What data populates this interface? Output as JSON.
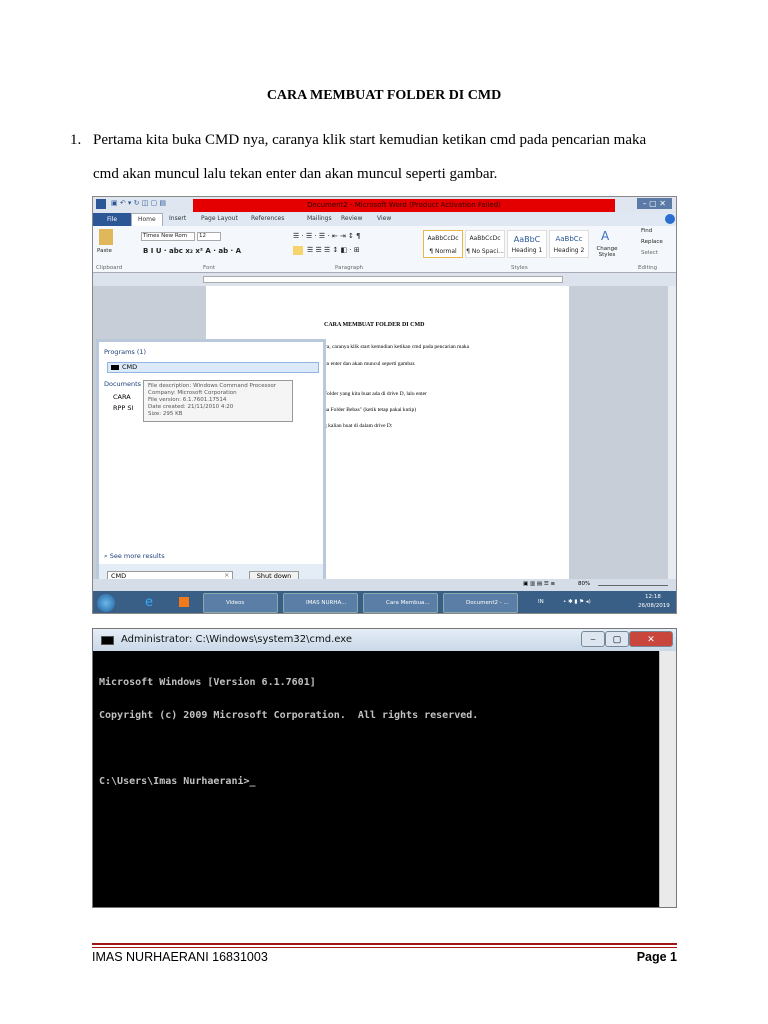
{
  "title": "CARA MEMBUAT FOLDER  DI CMD",
  "step": {
    "number": "1.",
    "line1": "Pertama kita buka CMD nya, caranya klik start kemudian ketikan cmd pada pencarian maka",
    "line2": "cmd akan muncul lalu tekan enter dan akan muncul seperti gambar."
  },
  "word": {
    "window_title": "Document2 - Microsoft Word (Product Activation Failed)",
    "tabs": [
      "File",
      "Home",
      "Insert",
      "Page Layout",
      "References",
      "Mailings",
      "Review",
      "View"
    ],
    "font_name": "Times New Rom",
    "font_size": "12",
    "groups": [
      "Clipboard",
      "Font",
      "Paragraph",
      "Styles",
      "Editing"
    ],
    "paste": "Paste",
    "styles": [
      {
        "preview": "AaBbCcDc",
        "name": "¶ Normal"
      },
      {
        "preview": "AaBbCcDc",
        "name": "¶ No Spaci..."
      },
      {
        "preview": "AaBbC",
        "name": "Heading 1"
      },
      {
        "preview": "AaBbCc",
        "name": "Heading 2"
      }
    ],
    "change_styles": "Change Styles",
    "editing": [
      "Find",
      "Replace",
      "Select"
    ],
    "page_title": "CARA MEMBUAT FOLDER  DI CMD",
    "page_lines": [
      "ya, caranya klik start kemudian ketikan cmd pada pencarian maka",
      "an enter dan akan muncul seperti gambar.",
      "Folder yang kita buat ada di drive D, lalu enter",
      "na Folder Bebas\" (ketik tetap pakai kutip)",
      "g kalian buat di dalam drive D:"
    ],
    "zoom": "80%",
    "start_menu": {
      "programs_header": "Programs (1)",
      "program": "CMD",
      "documents_header": "Documents",
      "docs": [
        "CARA",
        "RPP SI"
      ],
      "see_more": "See more results",
      "search_value": "CMD",
      "shutdown": "Shut down"
    },
    "tooltip": [
      "File description: Windows Command Processor",
      "Company: Microsoft Corporation",
      "File version: 6.1.7601.17514",
      "Date created: 21/11/2010 4:20",
      "Size: 295 KB"
    ],
    "taskbar": [
      "Videos",
      "IMAS NURHA...",
      "Cara Membua...",
      "Document2 - ..."
    ],
    "tray": {
      "lang": "IN",
      "time": "12:18",
      "date": "26/08/2019"
    }
  },
  "cmd": {
    "title": "Administrator: C:\\Windows\\system32\\cmd.exe",
    "lines": [
      "Microsoft Windows [Version 6.1.7601]",
      "Copyright (c) 2009 Microsoft Corporation.  All rights reserved.",
      "",
      "C:\\Users\\Imas Nurhaerani>_"
    ]
  },
  "footer": {
    "left": "IMAS NURHAERANI 16831003",
    "right": "Page 1"
  }
}
